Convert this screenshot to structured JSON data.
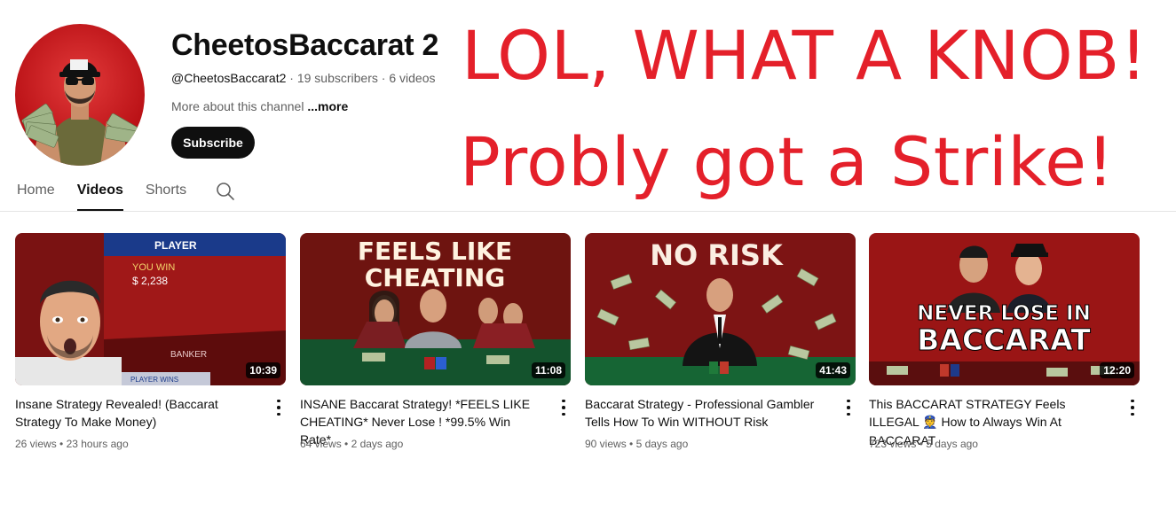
{
  "channel": {
    "name": "CheetosBaccarat 2",
    "handle": "@CheetosBaccarat2",
    "subscribers": "19 subscribers",
    "videos_count": "6 videos",
    "more_prefix": "More about this channel",
    "more_link": "...more",
    "subscribe_label": "Subscribe"
  },
  "overlay": {
    "line1": "LOL, WHAT A KNOB!",
    "line2": "Probly got a Strike!",
    "color": "#e4202a"
  },
  "tabs": [
    {
      "label": "Home",
      "active": false
    },
    {
      "label": "Videos",
      "active": true
    },
    {
      "label": "Shorts",
      "active": false
    }
  ],
  "videos": [
    {
      "title": "Insane Strategy Revealed! (Baccarat Strategy To Make Money)",
      "views": "26 views",
      "age": "23 hours ago",
      "duration": "10:39",
      "thumb_text": {
        "top": "PLAYER",
        "win": "YOU WIN",
        "amount": "$ 2,238",
        "banker": "BANKER",
        "player_wins": "PLAYER WINS"
      }
    },
    {
      "title": "INSANE Baccarat Strategy! *FEELS LIKE CHEATING* Never Lose ! *99.5% Win Rate*",
      "views": "64 views",
      "age": "2 days ago",
      "duration": "11:08",
      "thumb_text": {
        "line1": "FEELS LIKE",
        "line2": "CHEATING"
      }
    },
    {
      "title": "Baccarat Strategy - Professional Gambler Tells How To Win WITHOUT Risk",
      "views": "90 views",
      "age": "5 days ago",
      "duration": "41:43",
      "thumb_text": {
        "line1": "NO RISK"
      }
    },
    {
      "title_pre": "This BACCARAT STRATEGY Feels ILLEGAL",
      "title_emoji": "👮",
      "title_post": "How to Always Win At BACCARAT",
      "views": "723 views",
      "age": "5 days ago",
      "duration": "12:20",
      "thumb_text": {
        "line1": "NEVER LOSE IN",
        "line2": "BACCARAT"
      }
    }
  ],
  "stat_separator": " • ",
  "meta_separator": " · "
}
